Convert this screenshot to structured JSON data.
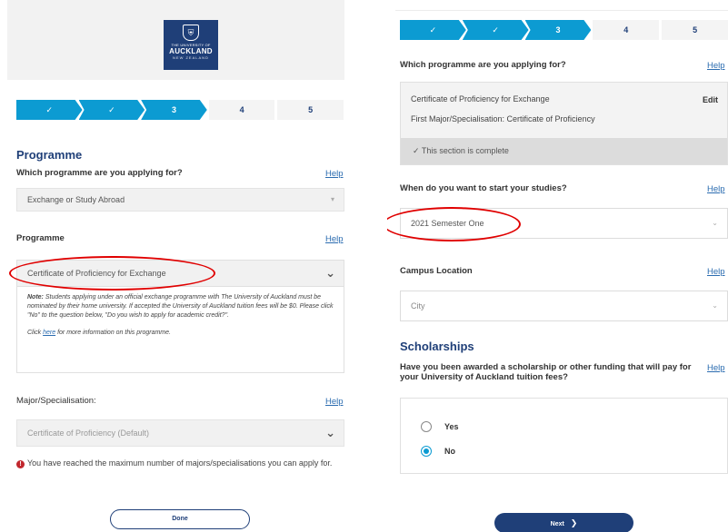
{
  "colors": {
    "navy": "#1f3f78",
    "step_blue": "#0c9bd2",
    "alert_red": "#e00000"
  },
  "logo": {
    "line1": "THE UNIVERSITY OF",
    "line2": "AUCKLAND",
    "line3": "NEW ZEALAND",
    "icon": "crest-icon"
  },
  "steps": [
    {
      "label": "✓",
      "state": "done"
    },
    {
      "label": "✓",
      "state": "done"
    },
    {
      "label": "3",
      "state": "current"
    },
    {
      "label": "4",
      "state": "todo"
    },
    {
      "label": "5",
      "state": "todo"
    }
  ],
  "left": {
    "section_title": "Programme",
    "q_programme_type": {
      "label": "Which programme are you applying for?",
      "help": "Help",
      "value": "Exchange or Study Abroad"
    },
    "q_programme": {
      "label": "Programme",
      "help": "Help",
      "value": "Certificate of Proficiency for Exchange"
    },
    "note": {
      "prefix": "Note:",
      "text": " Students applying under an official exchange programme with The University of Auckland must be nominated by their home university. If accepted the University of Auckland tuition fees will be $0. Please click \"No\" to the question below, \"Do you wish to apply for academic credit?\".",
      "click_before": "Click ",
      "link": "here",
      "click_after": " for more information on this programme."
    },
    "q_major": {
      "label": "Major/Specialisation:",
      "help": "Help",
      "value": "Certificate of Proficiency (Default)"
    },
    "warning": "You have reached the maximum number of majors/specialisations you can apply for.",
    "done_button": "Done"
  },
  "right": {
    "q_programme_summary": {
      "label": "Which programme are you applying for?",
      "help": "Help",
      "programme": "Certificate of Proficiency for Exchange",
      "edit": "Edit",
      "first_major": "First Major/Specialisation: Certificate of Proficiency",
      "complete": "This section is complete"
    },
    "q_start": {
      "label": "When do you want to start your studies?",
      "help": "Help",
      "value": "2021 Semester One"
    },
    "q_campus": {
      "label": "Campus Location",
      "help": "Help",
      "value": "City"
    },
    "scholarships": {
      "title": "Scholarships",
      "question": "Have you been awarded a scholarship or other funding that will pay for your University of Auckland tuition fees?",
      "help": "Help",
      "options": [
        "Yes",
        "No"
      ],
      "selected": "No"
    },
    "next_button": "Next",
    "next_icon": "chevron-right-icon"
  }
}
